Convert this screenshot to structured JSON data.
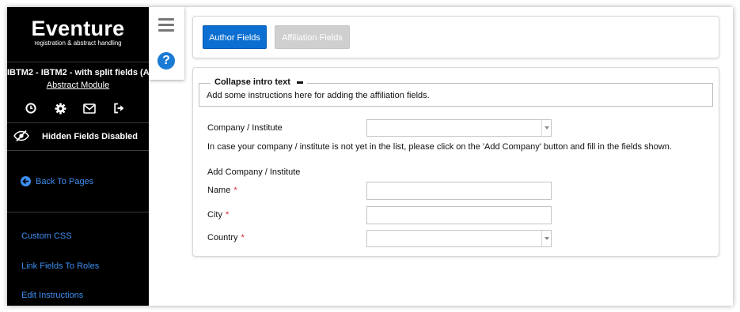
{
  "sidebar": {
    "logo_name": "Eventure",
    "logo_tagline": "registration & abstract handling",
    "project_title": "IBTM2 - IBTM2 - with split fields (A...",
    "module_link": "Abstract Module",
    "icons": [
      "history-icon",
      "gear-icon",
      "mail-icon",
      "logout-icon"
    ],
    "hidden_fields_label": "Hidden Fields Disabled",
    "back_label": "Back To Pages",
    "links": [
      "Custom CSS",
      "Link Fields To Roles",
      "Edit Instructions"
    ],
    "link_color": "#3d8ef0"
  },
  "toolbar": {
    "menu_icon": "hamburger-icon",
    "help_icon": "help-icon",
    "help_glyph": "?"
  },
  "tabs": [
    {
      "label": "Author Fields",
      "active": true
    },
    {
      "label": "Affiliation Fields",
      "active": false
    }
  ],
  "intro": {
    "legend": "Collapse intro text",
    "text": "Add some instructions here for adding the affiliation fields."
  },
  "form": {
    "company_label": "Company / Institute",
    "company_value": "",
    "company_note": "In case your company / institute is not yet in the list, please click on the 'Add Company' button and fill in the fields shown.",
    "add_heading": "Add Company / Institute",
    "name_label": "Name",
    "name_value": "",
    "city_label": "City",
    "city_value": "",
    "country_label": "Country",
    "country_value": "",
    "required_mark": "*"
  },
  "colors": {
    "accent": "#0b6fd1",
    "required": "#d9242c",
    "sidebar_bg": "#000000"
  }
}
